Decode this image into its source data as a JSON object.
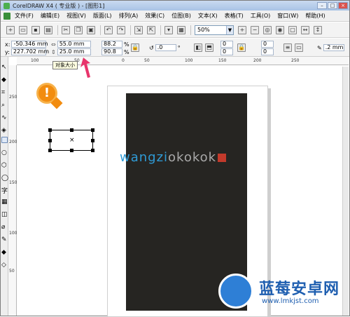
{
  "window": {
    "title": "CorelDRAW X4 ( 专业版 ) - [图形1]"
  },
  "menu": {
    "items": [
      "文件(F)",
      "编辑(E)",
      "视图(V)",
      "版面(L)",
      "排列(A)",
      "效果(C)",
      "位图(B)",
      "文本(X)",
      "表格(T)",
      "工具(O)",
      "窗口(W)",
      "帮助(H)"
    ]
  },
  "toolbar": {
    "zoom_value": "50%"
  },
  "propbar": {
    "x": "-50.346 mm",
    "y": "227.702 mm",
    "width": "55.0 mm",
    "height": "25.0 mm",
    "scale_x": "88.2",
    "scale_y": "90.8",
    "percent": "%",
    "rotation": ".0",
    "degree": "°",
    "v1": "0",
    "v2": "0",
    "v3": "0",
    "v4": "0",
    "outline": ".2 mm"
  },
  "tooltip": {
    "text": "对象大小"
  },
  "ruler": {
    "h_ticks": [
      "100",
      "50",
      "0",
      "50",
      "100",
      "150",
      "200",
      "250"
    ],
    "v_ticks": [
      "250",
      "200",
      "150",
      "100",
      "50"
    ]
  },
  "canvas": {
    "watermark_blue": "wangzi",
    "watermark_gray": "okokok"
  },
  "badge": {
    "symbol": "!"
  },
  "logo": {
    "title": "蓝莓安卓网",
    "url": "www.lmkjst.com"
  },
  "colors": {
    "black_rect": "#262522",
    "badge": "#f28c0f",
    "watermark_blue": "#2f9bd6",
    "logo_blue": "#1f5fb0"
  }
}
